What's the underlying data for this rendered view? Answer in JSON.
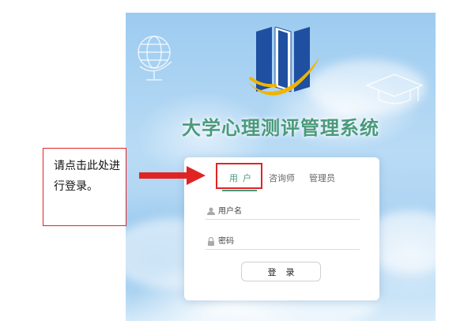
{
  "app": {
    "title": "大学心理测评管理系统"
  },
  "login": {
    "tabs": [
      {
        "label": "用户",
        "active": true
      },
      {
        "label": "咨询师",
        "active": false
      },
      {
        "label": "管理员",
        "active": false
      }
    ],
    "username": {
      "placeholder": "用户名",
      "value": "",
      "icon": "user-icon"
    },
    "password": {
      "placeholder": "密码",
      "value": "",
      "icon": "lock-icon"
    },
    "submit_label": "登录"
  },
  "annotation": {
    "callout_text": "请点击此处进行登录。",
    "arrow_icon": "right-arrow-icon",
    "highlight_color": "#e02424"
  },
  "colors": {
    "accent": "#4a9a7c",
    "logo_blue": "#1f4fa0",
    "logo_gold": "#f0b400",
    "annotation_red": "#e02424"
  }
}
